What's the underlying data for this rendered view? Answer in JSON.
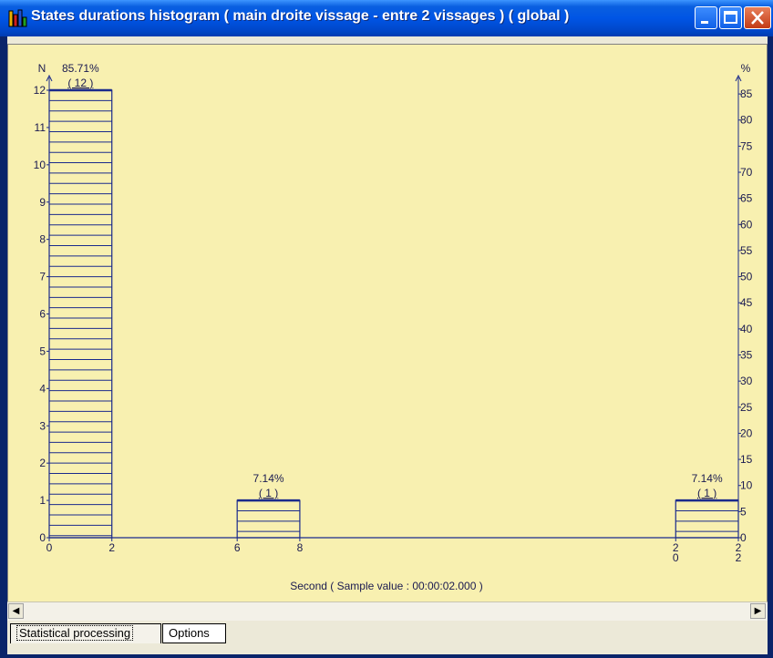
{
  "window": {
    "title": "States durations histogram ( main droite vissage - entre 2 vissages )  ( global )",
    "icon": "histogram-icon"
  },
  "chart_data": {
    "type": "bar",
    "y_left_label": "N",
    "y_right_label": "%",
    "x_caption": "Second ( Sample value : 00:00:02.000 )",
    "y_left_ticks": [
      "0",
      "1",
      "2",
      "3",
      "4",
      "5",
      "6",
      "7",
      "8",
      "9",
      "10",
      "11",
      "12"
    ],
    "y_right_ticks": [
      "0",
      "5",
      "10",
      "15",
      "20",
      "25",
      "30",
      "35",
      "40",
      "45",
      "50",
      "55",
      "60",
      "65",
      "70",
      "75",
      "80",
      "85"
    ],
    "y_left_range": [
      0,
      12
    ],
    "y_right_range": [
      0,
      85
    ],
    "x_range": [
      0,
      22
    ],
    "bins": [
      {
        "from": 0,
        "to": 2,
        "count": 12,
        "percent_label": "85.71%",
        "count_label": "( 12 )",
        "from_label": "0",
        "to_label": "2"
      },
      {
        "from": 6,
        "to": 8,
        "count": 1,
        "percent_label": "7.14%",
        "count_label": "( 1 )",
        "from_label": "6",
        "to_label": "8"
      },
      {
        "from": 20,
        "to": 22,
        "count": 1,
        "percent_label": "7.14%",
        "count_label": "( 1 )",
        "from_label": "2\n0",
        "to_label": "2\n2"
      }
    ],
    "colors": {
      "background": "#f8f0b0",
      "bars": "#1a2a8c"
    }
  },
  "tabs": [
    {
      "label": "Statistical processing",
      "active": true
    },
    {
      "label": "Options",
      "active": false
    }
  ]
}
